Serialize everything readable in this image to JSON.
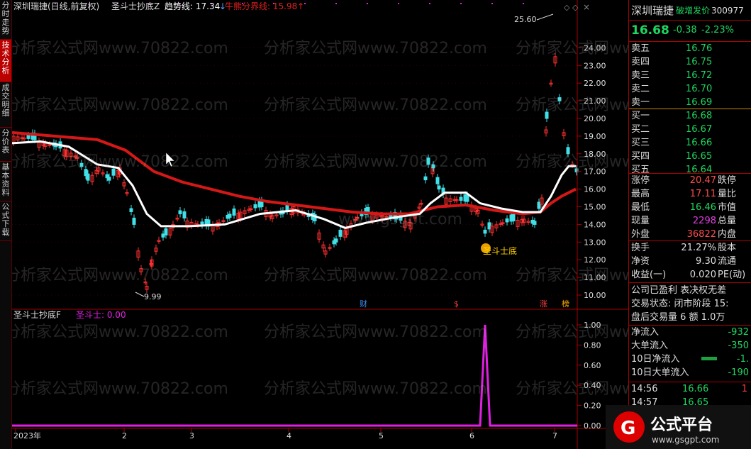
{
  "left_tabs": [
    "分时走势",
    "技术分析",
    "成交明细",
    "分价表",
    "基本资料",
    "公式下载"
  ],
  "header": {
    "stock": "深圳瑞捷(日线,前复权)",
    "indicator": "圣斗士抄底Z",
    "trend_label": "趋势线: 17.34",
    "bull_label": "牛熊分界线: 15.98"
  },
  "sub_header": {
    "indicator": "圣斗士抄底F",
    "series": "圣斗士: 0.00"
  },
  "annotations": {
    "high": "25.60",
    "low": "9.99",
    "signal": "圣斗士底",
    "cai": "财",
    "dollar": "$",
    "zhang": "涨",
    "bang": "榜"
  },
  "watermark": "分析家公式网www.70822.com",
  "watermark2": "www.gsgpt.com",
  "chart_data": [
    {
      "type": "candlestick",
      "y_ticks": [
        "24.00",
        "23.00",
        "22.00",
        "21.00",
        "20.00",
        "19.00",
        "18.00",
        "17.00",
        "16.00",
        "15.00",
        "14.00",
        "13.00",
        "12.00",
        "11.00",
        "10.00"
      ],
      "x_ticks": [
        "2023年",
        "2",
        "3",
        "4",
        "5",
        "6",
        "7"
      ],
      "series": [
        {
          "name": "趋势线",
          "color": "#ffffff",
          "last": 17.34
        },
        {
          "name": "牛熊分界线",
          "color": "#e01010",
          "last": 15.98
        }
      ]
    },
    {
      "type": "line",
      "y_ticks": [
        "1.00",
        "0.80",
        "0.60",
        "0.40",
        "0.20",
        "0.00"
      ],
      "series": [
        {
          "name": "圣斗士",
          "color": "#e020e0",
          "last": 0.0
        }
      ]
    }
  ],
  "right": {
    "name": "深圳瑞捷",
    "tag": "破增发价",
    "code": "300977",
    "price": "16.68",
    "change": "-0.38",
    "pct": "-2.23%",
    "asks": [
      {
        "l": "卖五",
        "p": "16.76"
      },
      {
        "l": "卖四",
        "p": "16.75"
      },
      {
        "l": "卖三",
        "p": "16.72"
      },
      {
        "l": "卖二",
        "p": "16.70"
      },
      {
        "l": "卖一",
        "p": "16.69"
      }
    ],
    "bids": [
      {
        "l": "买一",
        "p": "16.68"
      },
      {
        "l": "买二",
        "p": "16.67"
      },
      {
        "l": "买三",
        "p": "16.66"
      },
      {
        "l": "买四",
        "p": "16.65"
      },
      {
        "l": "买五",
        "p": "16.64"
      }
    ],
    "stats": [
      {
        "l": "涨停",
        "v": "20.47",
        "r": "跌停",
        "c": "red"
      },
      {
        "l": "最高",
        "v": "17.11",
        "r": "量比",
        "c": "red"
      },
      {
        "l": "最低",
        "v": "16.46",
        "r": "市值",
        "c": "green"
      },
      {
        "l": "现量",
        "v": "2298",
        "r": "总量",
        "c": "mag"
      },
      {
        "l": "外盘",
        "v": "36822",
        "r": "内盘",
        "c": "red"
      }
    ],
    "stats2": [
      {
        "l": "换手",
        "v": "21.27%",
        "r": "股本"
      },
      {
        "l": "净资",
        "v": "9.30",
        "r": "流通"
      },
      {
        "l": "收益(一)",
        "v": "0.020",
        "r": "PE(动)"
      }
    ],
    "info": [
      "公司已盈利 表决权无差",
      "交易状态: 闭市阶段 15:",
      "盘后交易量 6 额 1.0万"
    ],
    "flows": [
      {
        "l": "净流入",
        "v": "-932"
      },
      {
        "l": "大单流入",
        "v": "-350"
      },
      {
        "l": "10日净流入",
        "v": "-1."
      },
      {
        "l": "10日大单流入",
        "v": "-190"
      }
    ],
    "ticks": [
      {
        "t": "14:56",
        "p": "16.66",
        "v": "1"
      },
      {
        "t": "14:57",
        "p": "16.65",
        "v": ""
      }
    ]
  },
  "logo": {
    "text": "公式平台",
    "url": "www.gsgpt.com"
  }
}
